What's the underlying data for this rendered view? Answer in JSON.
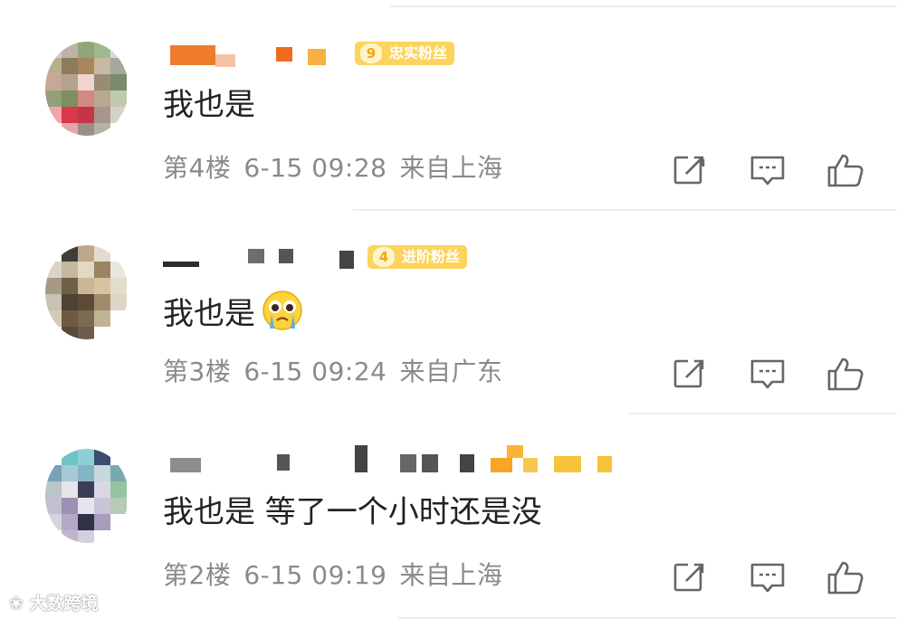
{
  "comments": [
    {
      "badge": {
        "level": "9",
        "label": "忠实粉丝"
      },
      "text": "我也是",
      "floor": "第4楼",
      "time": "6-15 09:28",
      "location": "来自上海",
      "emoji": ""
    },
    {
      "badge": {
        "level": "4",
        "label": "进阶粉丝"
      },
      "text": "我也是",
      "floor": "第3楼",
      "time": "6-15 09:24",
      "location": "来自广东",
      "emoji": "crying-face"
    },
    {
      "badge": null,
      "text": "我也是 等了一个小时还是没",
      "floor": "第2楼",
      "time": "6-15 09:19",
      "location": "来自上海",
      "emoji": ""
    }
  ],
  "icons": {
    "share": "share-icon",
    "reply": "comment-icon",
    "like": "thumbs-up-icon"
  },
  "colors": {
    "badge": "#fcd35c",
    "meta_text": "#8a8a8a",
    "body_text": "#222222",
    "icon": "#666666"
  },
  "watermark": "大数跨境"
}
